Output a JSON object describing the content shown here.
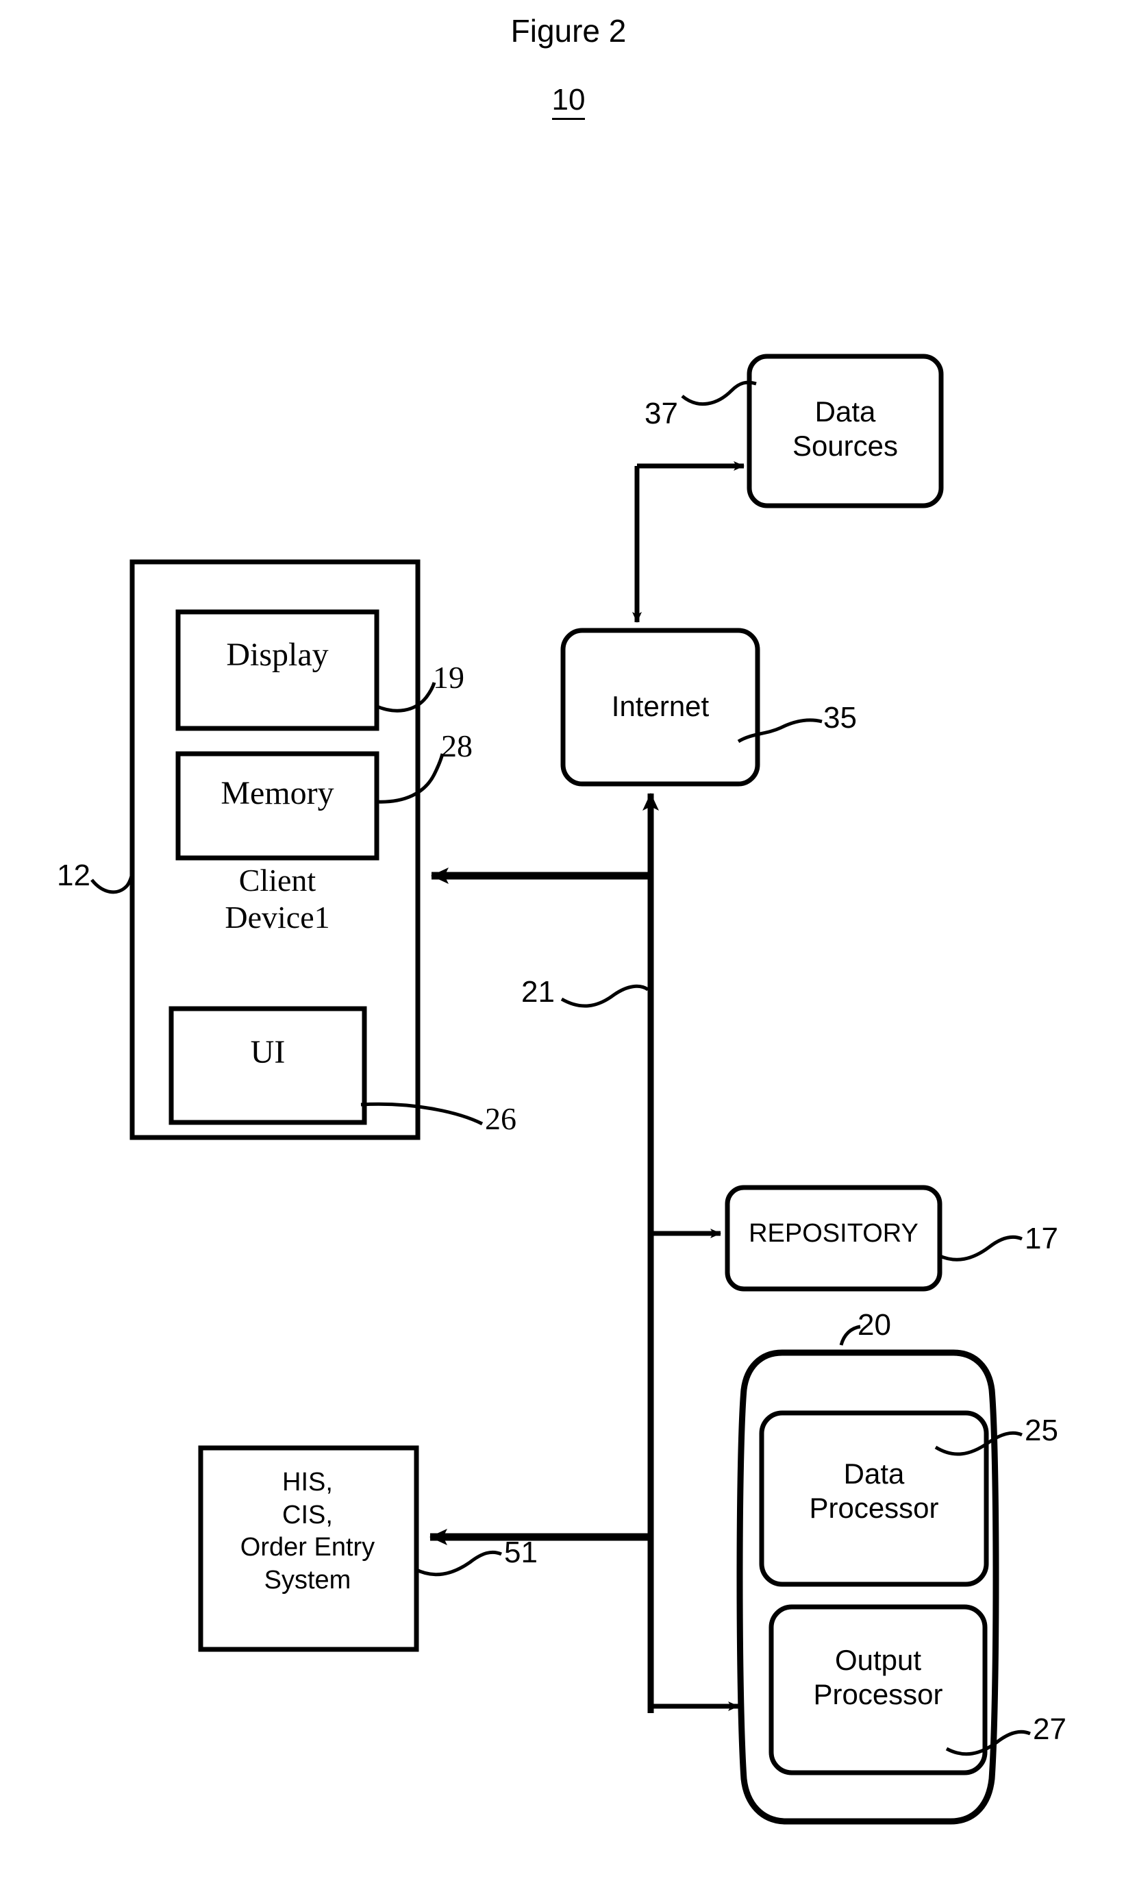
{
  "figure": {
    "title": "Figure 2",
    "number": "10"
  },
  "nodes": {
    "data_sources": {
      "label": "Data\nSources",
      "ref": "37"
    },
    "internet": {
      "label": "Internet",
      "ref": "35"
    },
    "client_device": {
      "label": "Client\nDevice1",
      "ref": "12"
    },
    "display": {
      "label": "Display",
      "ref": "19"
    },
    "memory": {
      "label": "Memory",
      "ref": "28"
    },
    "ui": {
      "label": "UI",
      "ref": "26"
    },
    "repository": {
      "label": "REPOSITORY",
      "ref": "17"
    },
    "server": {
      "ref": "20"
    },
    "data_processor": {
      "label": "Data\nProcessor",
      "ref": "25"
    },
    "output_processor": {
      "label": "Output\nProcessor",
      "ref": "27"
    },
    "his_cis": {
      "label": "HIS,\nCIS,\nOrder Entry\nSystem",
      "ref": "51"
    },
    "network_bus": {
      "ref": "21"
    }
  },
  "colors": {
    "stroke": "#000000",
    "background": "#ffffff"
  }
}
